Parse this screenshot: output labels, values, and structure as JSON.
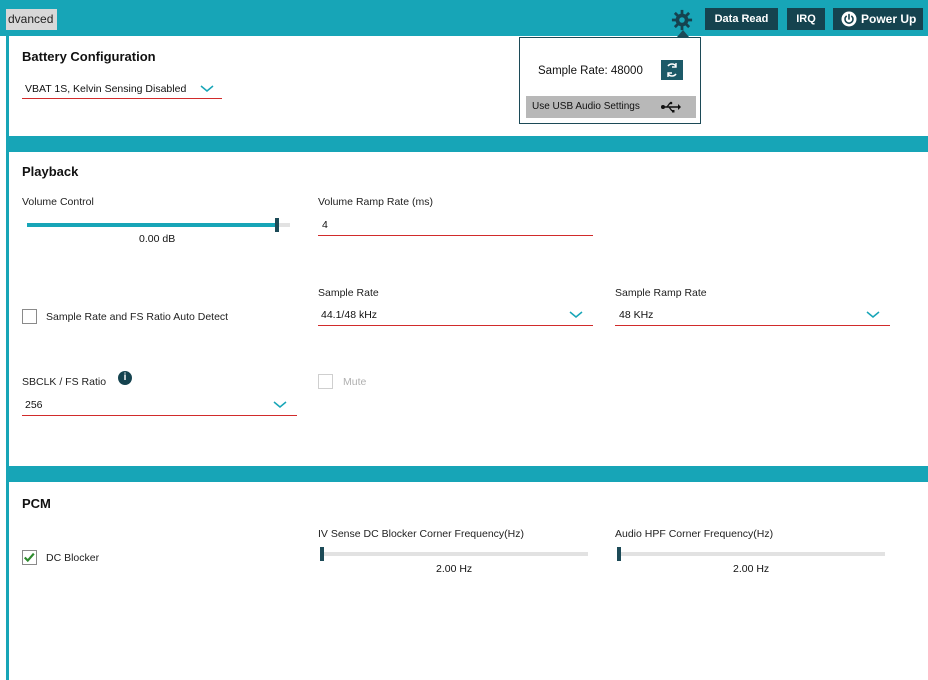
{
  "header": {
    "tab_label": "dvanced",
    "data_read_label": "Data Read",
    "irq_label": "IRQ",
    "power_label": "Power Up"
  },
  "colors": {
    "accent": "#17a5b7",
    "dark": "#15434f",
    "underline": "#d12b2b"
  },
  "popover": {
    "sample_rate_text": "Sample Rate: 48000",
    "usb_button_label": "Use USB Audio Settings"
  },
  "battery": {
    "title": "Battery Configuration",
    "selected": "VBAT 1S, Kelvin Sensing Disabled"
  },
  "playback": {
    "title": "Playback",
    "volume_label": "Volume Control",
    "volume_value": "0.00 dB",
    "volume_level": 0.95,
    "ramp_label": "Volume Ramp Rate (ms)",
    "ramp_value": "4",
    "auto_detect_label": "Sample Rate and FS Ratio Auto Detect",
    "auto_detect_checked": false,
    "sample_rate_label": "Sample Rate",
    "sample_rate_value": "44.1/48 kHz",
    "sample_ramp_label": "Sample Ramp Rate",
    "sample_ramp_value": "48 KHz",
    "sbclk_label": "SBCLK / FS Ratio",
    "sbclk_value": "256",
    "mute_label": "Mute",
    "mute_checked": false
  },
  "pcm": {
    "title": "PCM",
    "dc_blocker_label": "DC Blocker",
    "dc_blocker_checked": true,
    "iv_label": "IV Sense DC Blocker Corner Frequency(Hz)",
    "iv_value": "2.00 Hz",
    "iv_level": 0.0,
    "hpf_label": "Audio HPF Corner Frequency(Hz)",
    "hpf_value": "2.00 Hz",
    "hpf_level": 0.0
  }
}
